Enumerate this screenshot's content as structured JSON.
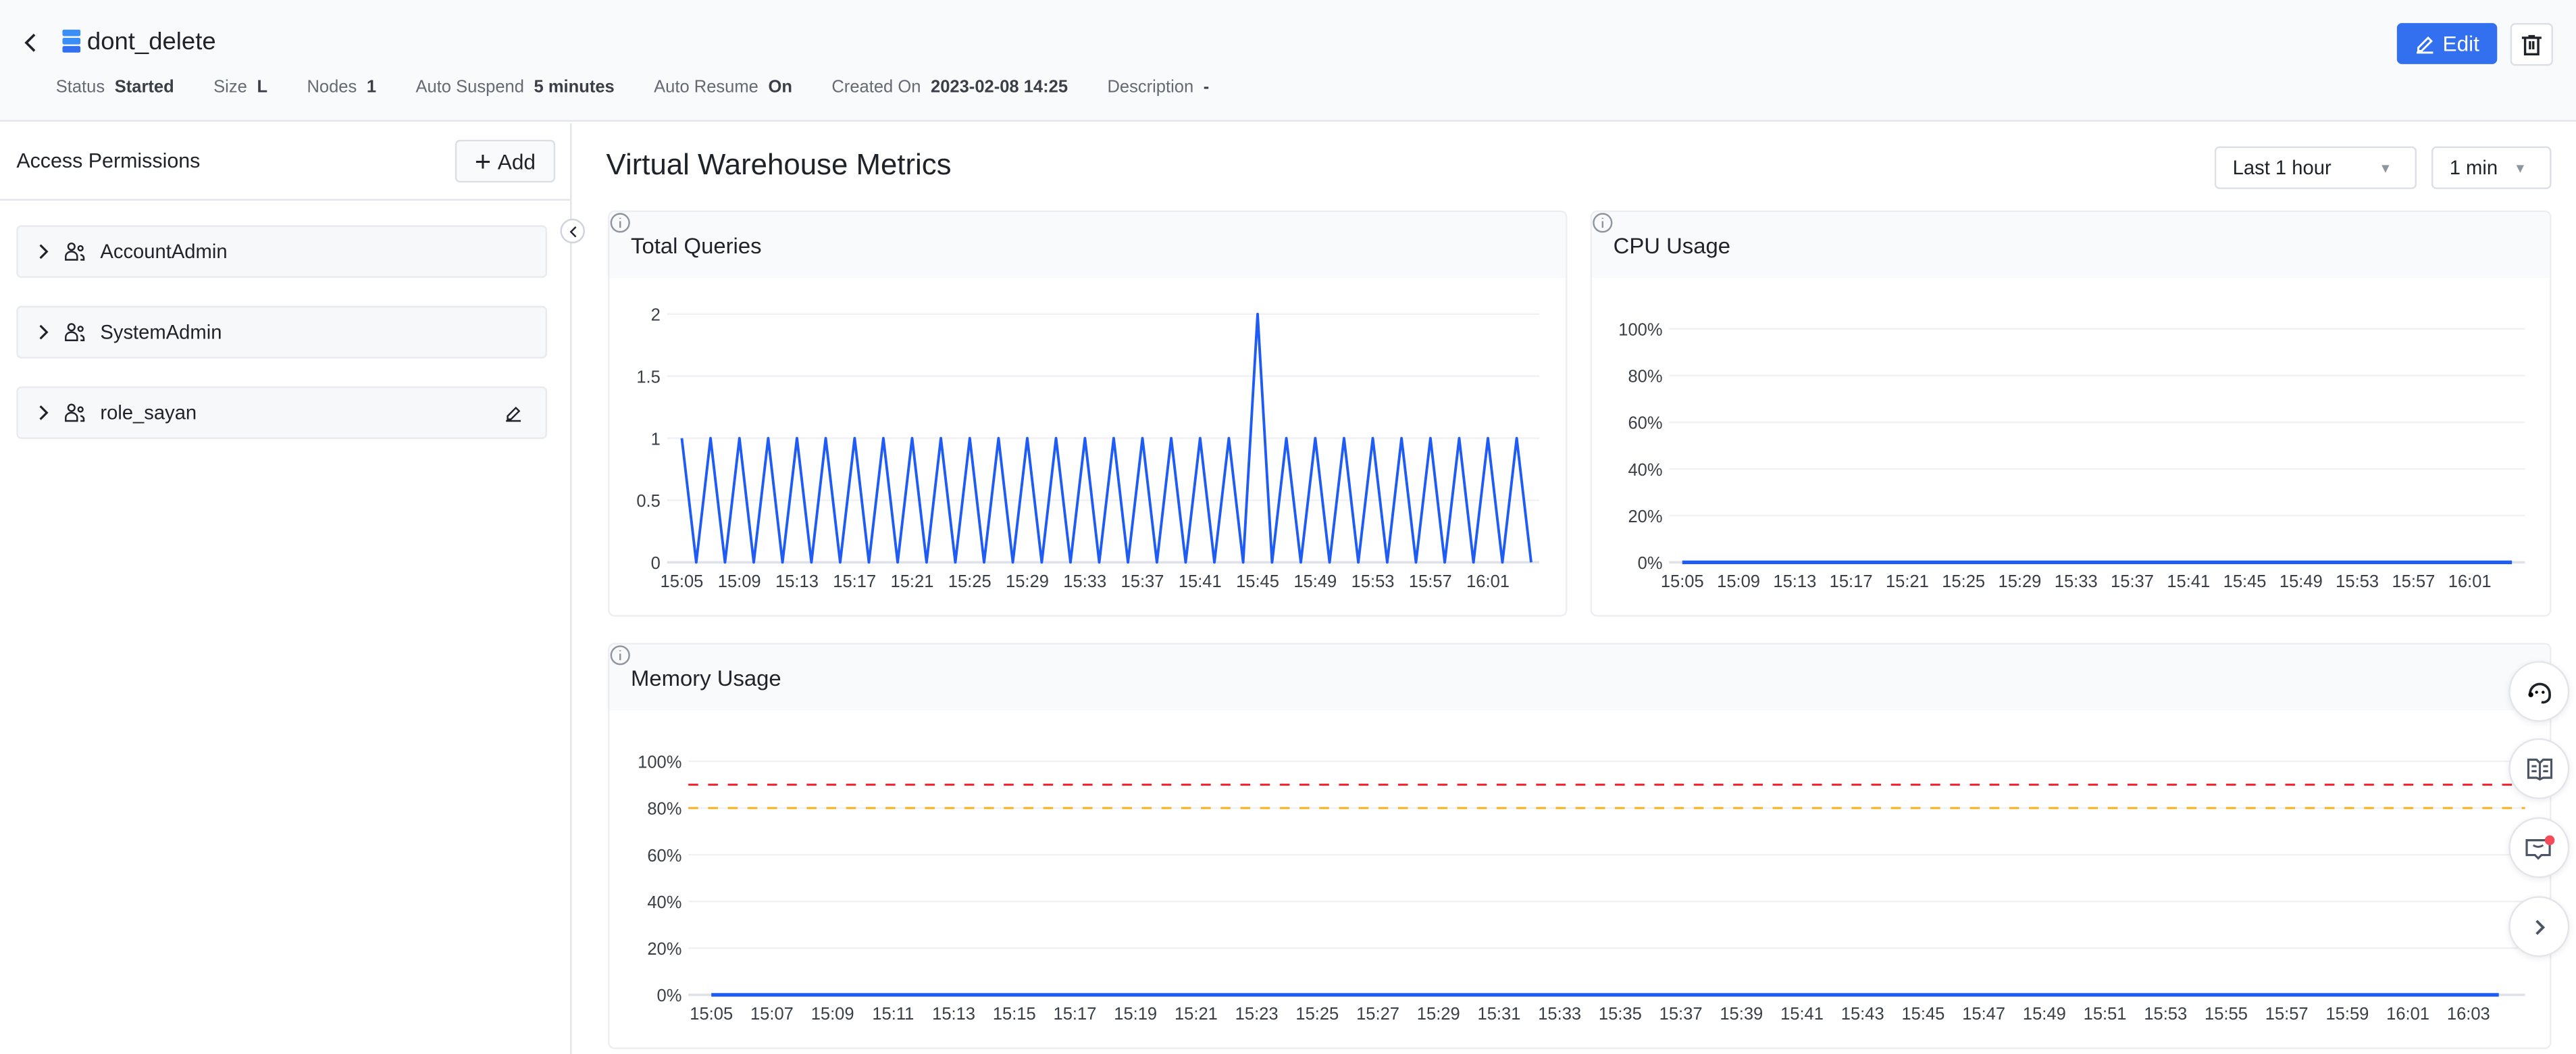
{
  "header": {
    "title": "dont_delete",
    "edit_label": "Edit",
    "meta": [
      {
        "label": "Status",
        "value": "Started"
      },
      {
        "label": "Size",
        "value": "L"
      },
      {
        "label": "Nodes",
        "value": "1"
      },
      {
        "label": "Auto Suspend",
        "value": "5 minutes"
      },
      {
        "label": "Auto Resume",
        "value": "On"
      },
      {
        "label": "Created On",
        "value": "2023-02-08 14:25"
      },
      {
        "label": "Description",
        "value": "-"
      }
    ]
  },
  "permissions": {
    "title": "Access Permissions",
    "add_label": "Add",
    "items": [
      {
        "name": "AccountAdmin",
        "editable": false
      },
      {
        "name": "SystemAdmin",
        "editable": false
      },
      {
        "name": "role_sayan",
        "editable": true
      }
    ]
  },
  "main": {
    "title": "Virtual Warehouse Metrics",
    "range": "Last 1 hour",
    "interval": "1 min"
  },
  "colors": {
    "accent": "#3370f0",
    "line": "#1f5cf5",
    "threshold_high": "#f5222d",
    "threshold_warn": "#faad14",
    "badge": "#f54a5a"
  },
  "chart_data": [
    {
      "title": "Total Queries",
      "type": "line",
      "ylim": [
        0,
        2
      ],
      "yticks": [
        "0",
        "0.5",
        "1",
        "1.5",
        "2"
      ],
      "ytick_values": [
        0,
        0.5,
        1,
        1.5,
        2
      ],
      "xticks": [
        "15:05",
        "15:09",
        "15:13",
        "15:17",
        "15:21",
        "15:25",
        "15:29",
        "15:33",
        "15:37",
        "15:41",
        "15:45",
        "15:49",
        "15:53",
        "15:57",
        "16:01"
      ],
      "x": [
        "15:05",
        "15:06",
        "15:07",
        "15:08",
        "15:09",
        "15:10",
        "15:11",
        "15:12",
        "15:13",
        "15:14",
        "15:15",
        "15:16",
        "15:17",
        "15:18",
        "15:19",
        "15:20",
        "15:21",
        "15:22",
        "15:23",
        "15:24",
        "15:25",
        "15:26",
        "15:27",
        "15:28",
        "15:29",
        "15:30",
        "15:31",
        "15:32",
        "15:33",
        "15:34",
        "15:35",
        "15:36",
        "15:37",
        "15:38",
        "15:39",
        "15:40",
        "15:41",
        "15:42",
        "15:43",
        "15:44",
        "15:45",
        "15:46",
        "15:47",
        "15:48",
        "15:49",
        "15:50",
        "15:51",
        "15:52",
        "15:53",
        "15:54",
        "15:55",
        "15:56",
        "15:57",
        "15:58",
        "15:59",
        "16:00",
        "16:01",
        "16:02",
        "16:03",
        "16:04"
      ],
      "y": [
        1,
        0,
        1,
        0,
        1,
        0,
        1,
        0,
        1,
        0,
        1,
        0,
        1,
        0,
        1,
        0,
        1,
        0,
        1,
        0,
        1,
        0,
        1,
        0,
        1,
        0,
        1,
        0,
        1,
        0,
        1,
        0,
        1,
        0,
        1,
        0,
        1,
        0,
        1,
        0,
        2,
        0,
        1,
        0,
        1,
        0,
        1,
        0,
        1,
        0,
        1,
        0,
        1,
        0,
        1,
        0,
        1,
        0,
        1,
        0
      ],
      "grid": true
    },
    {
      "title": "CPU Usage",
      "type": "line",
      "ylim": [
        0,
        100
      ],
      "yticks": [
        "0%",
        "20%",
        "40%",
        "60%",
        "80%",
        "100%"
      ],
      "ytick_values": [
        0,
        20,
        40,
        60,
        80,
        100
      ],
      "xticks": [
        "15:05",
        "15:09",
        "15:13",
        "15:17",
        "15:21",
        "15:25",
        "15:29",
        "15:33",
        "15:37",
        "15:41",
        "15:45",
        "15:49",
        "15:53",
        "15:57",
        "16:01"
      ],
      "x": [
        "15:05",
        "16:04"
      ],
      "y": [
        0,
        0
      ],
      "grid": true
    },
    {
      "title": "Memory Usage",
      "type": "line",
      "ylim": [
        0,
        100
      ],
      "yticks": [
        "0%",
        "20%",
        "40%",
        "60%",
        "80%",
        "100%"
      ],
      "ytick_values": [
        0,
        20,
        40,
        60,
        80,
        100
      ],
      "xticks": [
        "15:05",
        "15:07",
        "15:09",
        "15:11",
        "15:13",
        "15:15",
        "15:17",
        "15:19",
        "15:21",
        "15:23",
        "15:25",
        "15:27",
        "15:29",
        "15:31",
        "15:33",
        "15:35",
        "15:37",
        "15:39",
        "15:41",
        "15:43",
        "15:45",
        "15:47",
        "15:49",
        "15:51",
        "15:53",
        "15:55",
        "15:57",
        "15:59",
        "16:01",
        "16:03"
      ],
      "x": [
        "15:05",
        "16:04"
      ],
      "y": [
        0,
        0
      ],
      "thresholds": [
        {
          "value": 90,
          "color": "#f5222d"
        },
        {
          "value": 80,
          "color": "#faad14"
        }
      ],
      "grid": true
    }
  ]
}
